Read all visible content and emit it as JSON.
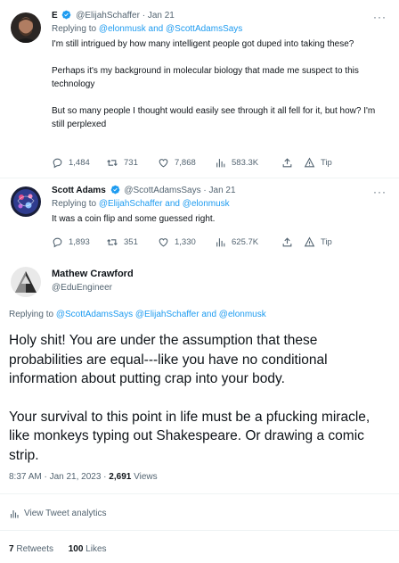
{
  "tweets": [
    {
      "name": "E",
      "handle": "@ElijahSchaffer",
      "dot": "·",
      "date": "Jan 21",
      "replying_prefix": "Replying to",
      "replying_to": "@elonmusk and @ScottAdamsSays",
      "paragraphs": [
        "I'm still intrigued by how many intelligent people got duped into taking these?",
        "Perhaps it's my background in molecular biology that made me suspect to this technology",
        "But so many people I thought would easily see through it all fell for it, but how? I'm still perplexed"
      ],
      "replies": "1,484",
      "retweets": "731",
      "likes": "7,868",
      "views": "583.3K",
      "tip": "Tip"
    },
    {
      "name": "Scott Adams",
      "handle": "@ScottAdamsSays",
      "dot": "·",
      "date": "Jan 21",
      "replying_prefix": "Replying to",
      "replying_to": "@ElijahSchaffer and @elonmusk",
      "paragraphs": [
        "It was a coin flip and some guessed right."
      ],
      "replies": "1,893",
      "retweets": "351",
      "likes": "1,330",
      "views": "625.7K",
      "tip": "Tip"
    }
  ],
  "focused": {
    "name": "Mathew Crawford",
    "handle": "@EduEngineer",
    "replying_prefix": "Replying to",
    "replying_to": "@ScottAdamsSays @ElijahSchaffer and @elonmusk",
    "paragraphs": [
      "Holy shit! You are under the assumption that these probabilities are equal---like you have no conditional information about putting crap into your body.",
      "Your survival to this point in life must be a pfucking miracle, like monkeys typing out Shakespeare. Or drawing a comic strip."
    ],
    "timestamp": "8:37 AM · Jan 21, 2023 · ",
    "views_count": "2,691",
    "views_label": " Views",
    "analytics_label": "View Tweet analytics",
    "retweets_count": "7",
    "retweets_label": " Retweets",
    "likes_count": "100",
    "likes_label": " Likes"
  },
  "colors": {
    "link": "#1d9bf0",
    "muted": "#536471",
    "text": "#0f1419",
    "divider": "#eff3f4"
  },
  "icons": [
    "more-icon",
    "verified-badge-icon",
    "reply-icon",
    "retweet-icon",
    "like-icon",
    "views-icon",
    "share-icon",
    "tip-icon",
    "analytics-icon"
  ]
}
